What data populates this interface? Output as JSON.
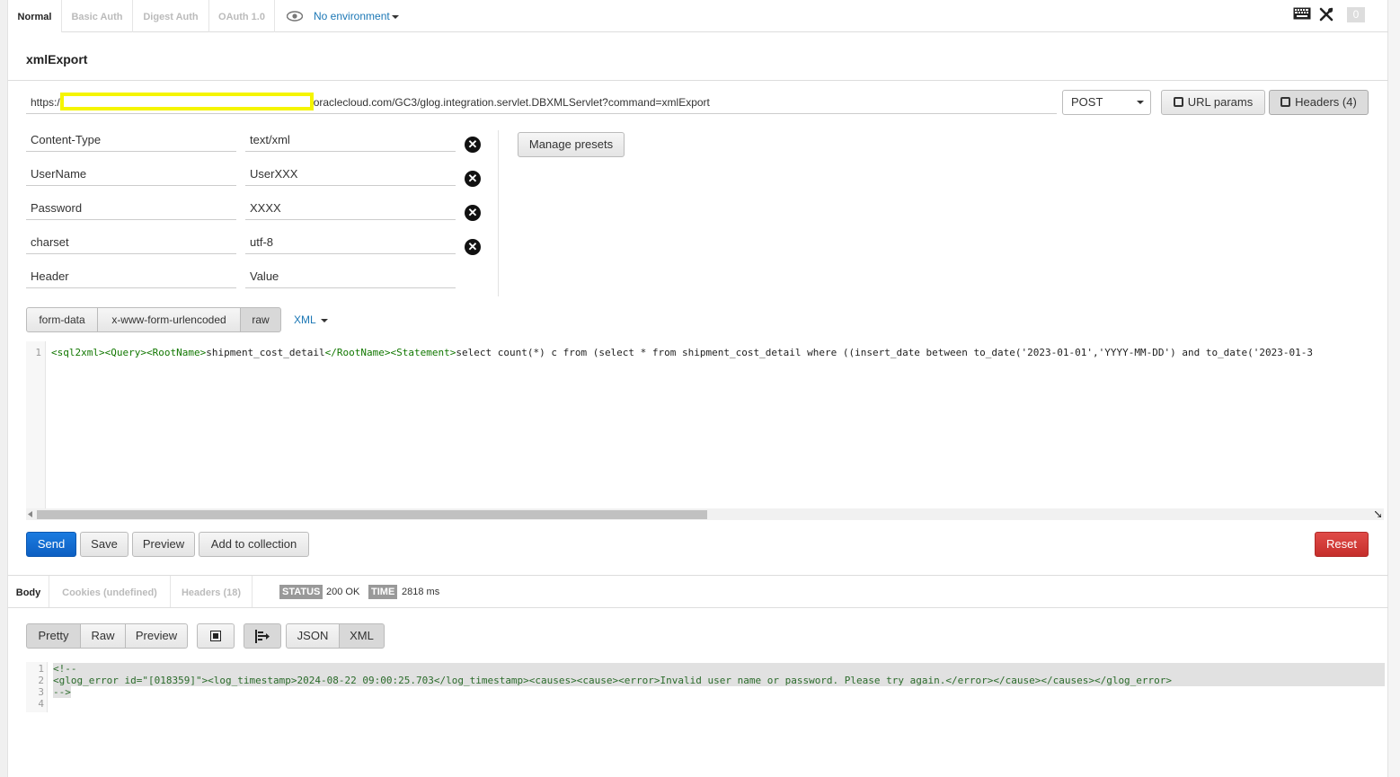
{
  "top_tabs": [
    "Normal",
    "Basic Auth",
    "Digest Auth",
    "OAuth 1.0"
  ],
  "environment": "No environment",
  "notification_count": "0",
  "request_name": "xmlExport",
  "url": {
    "prefix": "https:/",
    "suffix": "oraclecloud.com/GC3/glog.integration.servlet.DBXMLServlet?command=xmlExport"
  },
  "method": "POST",
  "buttons": {
    "url_params": "URL params",
    "headers": "Headers (4)",
    "manage_presets": "Manage presets"
  },
  "headers": [
    {
      "key": "Content-Type",
      "value": "text/xml"
    },
    {
      "key": "UserName",
      "value": "UserXXX"
    },
    {
      "key": "Password",
      "value": "XXXX"
    },
    {
      "key": "charset",
      "value": "utf-8"
    }
  ],
  "header_placeholder": {
    "key": "Header",
    "value": "Value"
  },
  "body_modes": [
    "form-data",
    "x-www-form-urlencoded",
    "raw"
  ],
  "body_type": "XML",
  "request_body": {
    "line_number": "1",
    "segments": [
      "<sql2xml>",
      "<Query>",
      "<RootName>",
      "shipment_cost_detail",
      "</RootName>",
      "<Statement>",
      "select count(*) c from (select * from shipment_cost_detail where ((insert_date between to_date('2023-01-01','YYYY-MM-DD') and to_date('2023-01-3"
    ]
  },
  "actions": {
    "send": "Send",
    "save": "Save",
    "preview": "Preview",
    "add_to_collection": "Add to collection",
    "reset": "Reset"
  },
  "response_tabs": [
    "Body",
    "Cookies (undefined)",
    "Headers (18)"
  ],
  "status": {
    "status_label": "STATUS",
    "status_value": "200 OK",
    "time_label": "TIME",
    "time_value": "2818 ms"
  },
  "view_modes": [
    "Pretty",
    "Raw",
    "Preview"
  ],
  "format_modes": [
    "JSON",
    "XML"
  ],
  "response_body": {
    "line_numbers": [
      "1",
      "2",
      "3",
      "4"
    ],
    "lines": [
      "<!--",
      "<glog_error id=\"[018359]\"><log_timestamp>2024-08-22 09:00:25.703</log_timestamp><causes><cause><error>Invalid user name or password. Please try again.</error></cause></causes></glog_error>",
      "-->",
      ""
    ]
  }
}
